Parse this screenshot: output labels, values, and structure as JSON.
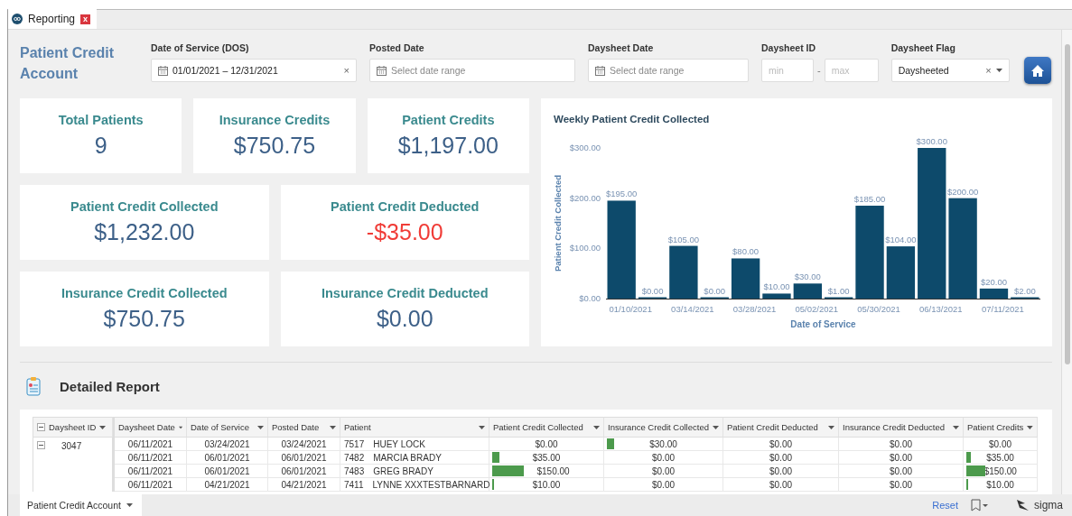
{
  "tab": {
    "title": "Reporting",
    "close": "x"
  },
  "page_title": "Patient Credit Account",
  "filters": [
    {
      "kind": "daterange",
      "label": "Date of Service (DOS)",
      "value": "01/01/2021 – 12/31/2021",
      "clear": "×"
    },
    {
      "kind": "daterange",
      "label": "Posted Date",
      "placeholder": "Select date range"
    },
    {
      "kind": "daterange",
      "label": "Daysheet Date",
      "placeholder": "Select date range"
    },
    {
      "kind": "range",
      "label": "Daysheet ID",
      "min_placeholder": "min",
      "separator": "-",
      "max_placeholder": "max"
    },
    {
      "kind": "select",
      "label": "Daysheet Flag",
      "value": "Daysheeted",
      "clear": "×"
    }
  ],
  "kpis": [
    {
      "label": "Total Patients",
      "value": "9",
      "negative": false
    },
    {
      "label": "Insurance Credits",
      "value": "$750.75",
      "negative": false
    },
    {
      "label": "Patient Credits",
      "value": "$1,197.00",
      "negative": false
    },
    {
      "label": "Patient Credit Collected",
      "value": "$1,232.00",
      "negative": false
    },
    {
      "label": "Patient Credit Deducted",
      "value": "-$35.00",
      "negative": true
    },
    {
      "label": "Insurance Credit Collected",
      "value": "$750.75",
      "negative": false
    },
    {
      "label": "Insurance Credit Deducted",
      "value": "$0.00",
      "negative": false
    }
  ],
  "chart": {
    "chart_data": {
      "type": "bar",
      "title": "Weekly Patient Credit Collected",
      "xlabel": "Date of Service",
      "ylabel": "Patient Credit Collected",
      "categories": [
        "01/10/2021",
        null,
        "03/14/2021",
        null,
        "03/28/2021",
        null,
        "05/02/2021",
        null,
        "05/30/2021",
        null,
        "06/13/2021",
        null,
        "07/11/2021",
        null
      ],
      "series": [
        {
          "color": "#0d4a6b",
          "values": [
            195,
            0,
            105,
            0,
            80,
            10,
            30,
            1,
            185,
            104,
            300,
            200,
            20,
            2
          ]
        }
      ],
      "ylim": [
        0,
        300
      ],
      "yticks": [
        {
          "value": 0,
          "label": "$0.00"
        },
        {
          "value": 100,
          "label": "$100.00"
        },
        {
          "value": 200,
          "label": "$200.00"
        },
        {
          "value": 300,
          "label": "$300.00"
        }
      ],
      "value_labels": [
        "$195.00",
        "$0.00",
        "$105.00",
        "$0.00",
        "$80.00",
        "$10.00",
        "$30.00",
        "$1.00",
        "$185.00",
        "$104.00",
        "$300.00",
        "$200.00",
        "$20.00",
        "$2.00"
      ]
    }
  },
  "report": {
    "title": "Detailed Report"
  },
  "table": {
    "columns": [
      "Daysheet ID",
      "Daysheet Date",
      "Date of Service",
      "Posted Date",
      "Patient",
      "Patient Credit Collected",
      "Insurance Credit Collected",
      "Patient Credit Deducted",
      "Insurance Credit Deducted",
      "Patient Credits"
    ],
    "group": {
      "id": "3047",
      "expanded": true
    },
    "rows": [
      {
        "daysheet_date": "06/11/2021",
        "date_of_service": "03/24/2021",
        "posted_date": "03/24/2021",
        "patient_id": "7517",
        "patient": "HUEY LOCK",
        "amounts": [
          {
            "text": "$0.00"
          },
          {
            "text": "$30.00",
            "level": 0.06
          },
          {
            "text": "$0.00"
          },
          {
            "text": "$0.00"
          },
          {
            "text": "$0.00"
          }
        ]
      },
      {
        "daysheet_date": "06/11/2021",
        "date_of_service": "06/01/2021",
        "posted_date": "06/01/2021",
        "patient_id": "7482",
        "patient": "MARCIA BRADY",
        "amounts": [
          {
            "text": "$35.00",
            "level": 0.07
          },
          {
            "text": "$0.00"
          },
          {
            "text": "$0.00"
          },
          {
            "text": "$0.00"
          },
          {
            "text": "$35.00",
            "level": 0.07
          }
        ]
      },
      {
        "daysheet_date": "06/11/2021",
        "date_of_service": "06/01/2021",
        "posted_date": "06/01/2021",
        "patient_id": "7483",
        "patient": "GREG BRADY",
        "amounts": [
          {
            "text": "$150.00",
            "level": 0.29
          },
          {
            "text": "$0.00"
          },
          {
            "text": "$0.00"
          },
          {
            "text": "$0.00"
          },
          {
            "text": "$150.00",
            "level": 0.27
          }
        ]
      },
      {
        "daysheet_date": "06/11/2021",
        "date_of_service": "04/21/2021",
        "posted_date": "04/21/2021",
        "patient_id": "7411",
        "patient": "LYNNE XXXTESTBARNARD",
        "amounts": [
          {
            "text": "$10.00",
            "level": 0.02
          },
          {
            "text": "$0.00"
          },
          {
            "text": "$0.00"
          },
          {
            "text": "$0.00"
          },
          {
            "text": "$10.00",
            "level": 0.02
          }
        ]
      }
    ]
  },
  "footer": {
    "page_tab": "Patient Credit Account",
    "reset": "Reset",
    "brand": "sigma"
  }
}
